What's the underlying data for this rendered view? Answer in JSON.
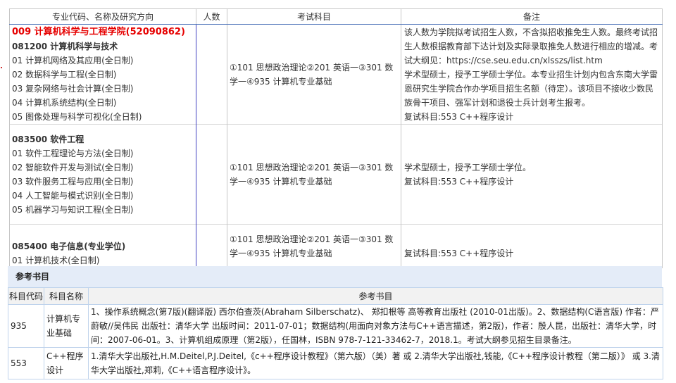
{
  "main_table": {
    "headers": [
      "专业代码、名称及研究方向",
      "人数",
      "考试科目",
      "备注"
    ],
    "department": "009 计算机科学与工程学院(52090862)",
    "rows": [
      {
        "major": "081200 计算机科学与技术",
        "directions": [
          "01 计算机网络及其应用(全日制)",
          "02 数据科学与工程(全日制)",
          "03 复杂网络与社会计算(全日制)",
          "04 计算机系统结构(全日制)",
          "05 图像处理与科学可视化(全日制)"
        ],
        "count": "",
        "exam": "①101 思想政治理论②201 英语一③301 数学一④935 计算机专业基础",
        "remarks": [
          "该人数为学院拟考试招生人数，不含拟招收推免生人数。最终考试招生人数根据教育部下达计划及实际录取推免人数进行相应的增减。考试大纲见：https://cse.seu.edu.cn/xlsszs/list.htm",
          "学术型硕士，授予工学硕士学位。本专业招生计划内包含东南大学雷恩研究生学院合作办学项目招生名额（待定）。该项目不接收少数民族骨干项目、强军计划和退役士兵计划考生报考。",
          "复试科目:553 C++程序设计"
        ]
      },
      {
        "major": "083500 软件工程",
        "directions": [
          "01 软件工程理论与方法(全日制)",
          "02 智能软件开发与测试(全日制)",
          "03 软件服务工程与应用(全日制)",
          "04 人工智能与模式识别(全日制)",
          "05 机器学习与知识工程(全日制)"
        ],
        "count": "",
        "exam": "①101 思想政治理论②201 英语一③301 数学一④935 计算机专业基础",
        "remarks": [
          "学术型硕士，授予工学硕士学位。",
          "复试科目:553 C++程序设计"
        ]
      },
      {
        "major": "085400 电子信息(专业学位)",
        "directions": [
          "01 计算机技术(全日制)"
        ],
        "count": "",
        "exam": "①101 思想政治理论②201 英语一③301 数学一④935 计算机专业基础",
        "remarks": [
          "复试科目:553 C++程序设计"
        ]
      }
    ]
  },
  "reference": {
    "title": "参考书目",
    "headers": [
      "科目代码",
      "科目名称",
      "参考书目"
    ],
    "rows": [
      {
        "code": "935",
        "name": "计算机专业基础",
        "books": "1、操作系统概念(第7版)(翻译版) 西尔伯查茨(Abraham Silberschatz)、 郑扣根等 高等教育出版社 (2010-01出版)。2、数据结构(C语言版) 作者：严蔚敏//吴伟民 出版社：清华大学 出版时间：2011-07-01；数据结构(用面向对象方法与C++语言描述，第2版)，作者：殷人昆，出版社：清华大学，时间：2007-06-01。3、计算机组成原理（第2版），任国林，ISBN 978-7-121-33462-7，2018.1。考试大纲参见招生目录备注。"
      },
      {
        "code": "553",
        "name": "C++程序设计",
        "books": "1.清华大学出版社,H.M.Deitel,P.J.Deitel,《c++程序设计教程》（第六版）（美）著 或 2.清华大学出版社,钱能,《C++程序设计教程（第二版）》 或 3.清华大学出版社,郑莉,《C++语言程序设计》。"
      }
    ]
  }
}
